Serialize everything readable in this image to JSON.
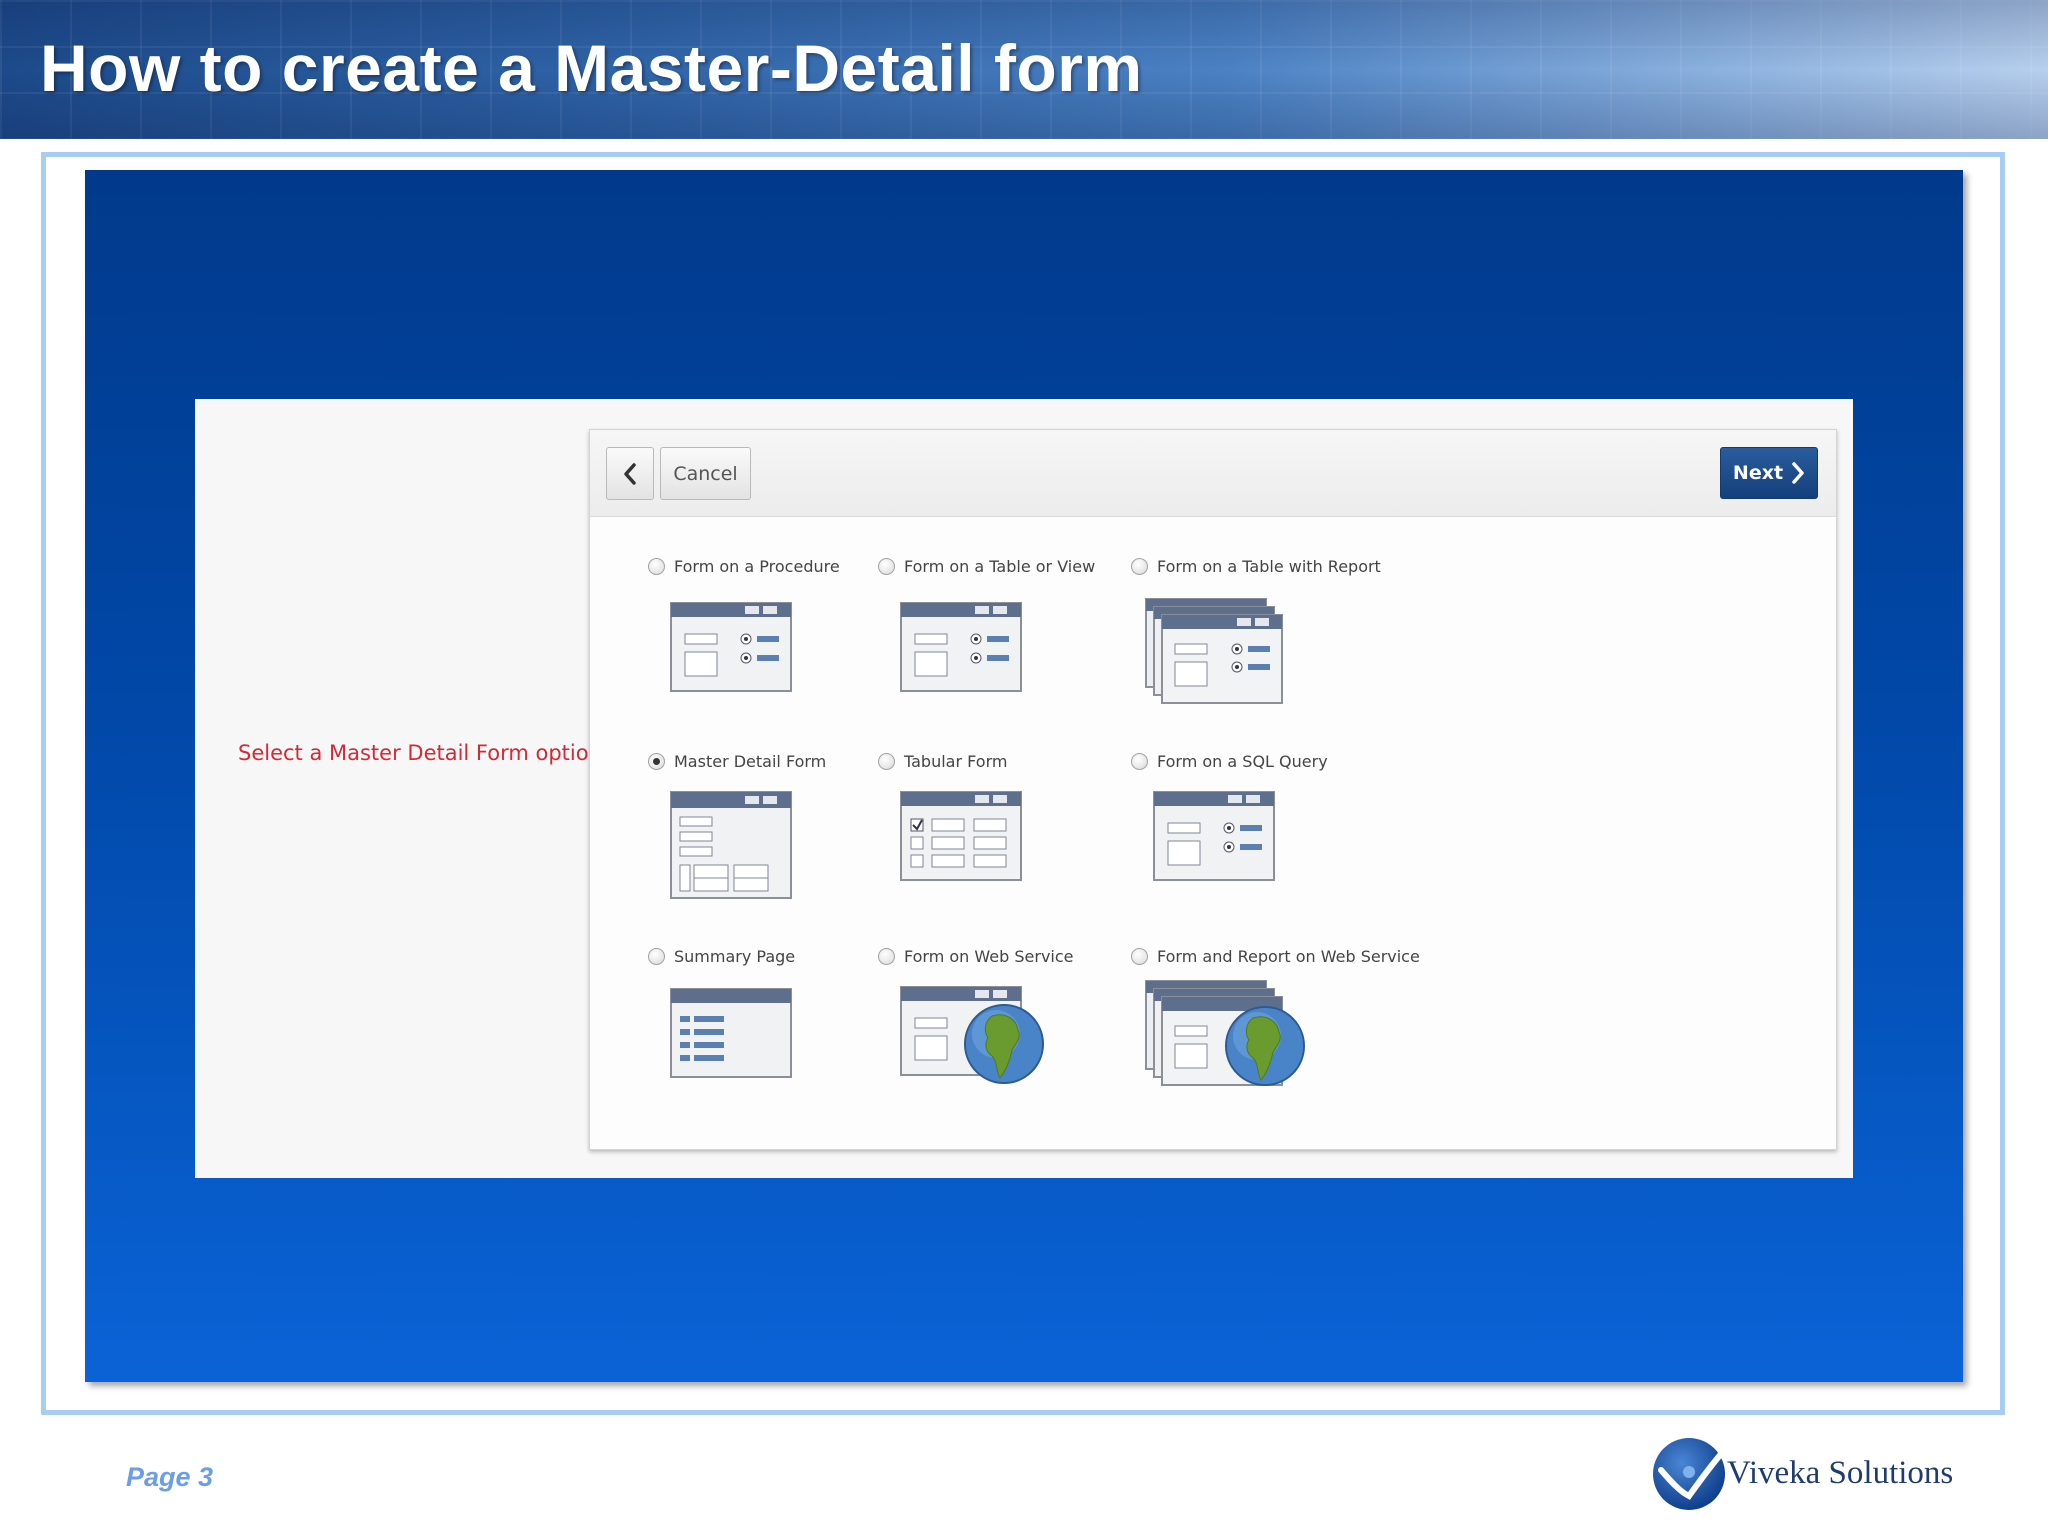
{
  "slide": {
    "title": "How to create a Master-Detail form",
    "page_label": "Page 3",
    "brand": "Viveka Solutions"
  },
  "callout": "Select a Master Detail Form option",
  "wizard": {
    "cancel_label": "Cancel",
    "next_label": "Next",
    "options": [
      {
        "label": "Form on a Procedure",
        "selected": false,
        "icon": "form-icon"
      },
      {
        "label": "Form on a Table or View",
        "selected": false,
        "icon": "form-icon"
      },
      {
        "label": "Form on a Table with Report",
        "selected": false,
        "icon": "form-report-icon"
      },
      {
        "label": "Master Detail Form",
        "selected": true,
        "icon": "master-detail-icon"
      },
      {
        "label": "Tabular Form",
        "selected": false,
        "icon": "tabular-form-icon"
      },
      {
        "label": "Form on a SQL Query",
        "selected": false,
        "icon": "form-icon"
      },
      {
        "label": "Summary Page",
        "selected": false,
        "icon": "summary-page-icon"
      },
      {
        "label": "Form on Web Service",
        "selected": false,
        "icon": "web-service-form-icon"
      },
      {
        "label": "Form and Report on Web Service",
        "selected": false,
        "icon": "web-service-report-icon"
      }
    ]
  }
}
